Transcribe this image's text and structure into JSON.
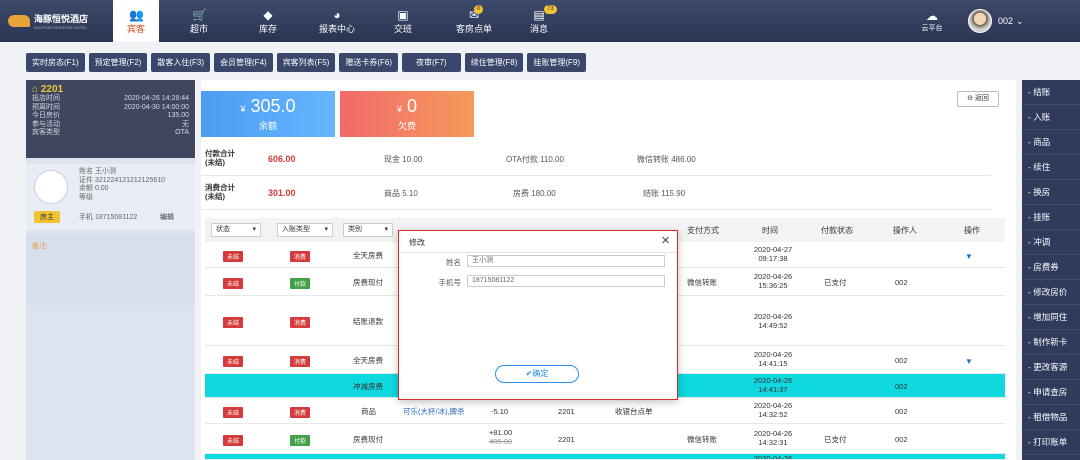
{
  "brand": {
    "name": "海豚恒悦酒店",
    "sub": "DOLPHIN HENGYUE HOTEL"
  },
  "nav": [
    {
      "label": "宾客",
      "icon": "guests-icon"
    },
    {
      "label": "超市",
      "icon": "cart-icon"
    },
    {
      "label": "库存",
      "icon": "box-icon"
    },
    {
      "label": "报表中心",
      "icon": "chart-icon"
    },
    {
      "label": "交班",
      "icon": "handover-icon"
    },
    {
      "label": "客房点单",
      "icon": "order-icon",
      "badge": "0"
    },
    {
      "label": "消息",
      "icon": "message-icon",
      "badge": "73"
    }
  ],
  "cloud_label": "云平台",
  "user_name": "002",
  "tabs": [
    "实时房态(F1)",
    "预定管理(F2)",
    "散客入住(F3)",
    "会员管理(F4)",
    "宾客列表(F5)",
    "赠送卡券(F6)",
    "夜审(F7)",
    "续住管理(F8)",
    "挂账管理(F9)"
  ],
  "room": {
    "number": "2201",
    "rows": [
      {
        "k": "抵店时间",
        "v": "2020-04-26 14:28:44"
      },
      {
        "k": "预离时间",
        "v": "2020-04-30 14:00:00"
      },
      {
        "k": "今日房价",
        "v": "135.00"
      },
      {
        "k": "参与活动",
        "v": "无"
      },
      {
        "k": "宾客类型",
        "v": "OTA"
      }
    ]
  },
  "guest": {
    "name": "姓名  王小测",
    "id": "证件  321224121212125610",
    "balance": "余额  0.00",
    "level": "等级",
    "master": "房主",
    "phone": "手机  18715081122",
    "edit": "编辑",
    "remark": "备注:"
  },
  "summary": {
    "balance_value": "305.0",
    "balance_label": "余额",
    "arrears_value": "0",
    "arrears_label": "欠费",
    "currency": "¥",
    "back": "返回",
    "pay_label_1": "付款合计",
    "pay_label_2": "(未结)",
    "pay_total": "606.00",
    "pay_items": [
      "现金  10.00",
      "OTA付款  110.00",
      "微信转账  486.00"
    ],
    "cons_label_1": "消费合计",
    "cons_label_2": "(未结)",
    "cons_total": "301.00",
    "cons_items": [
      "商品  5.10",
      "房费  180.00",
      "结账  115.90"
    ]
  },
  "table": {
    "filters": [
      "状态",
      "入账类型",
      "类别"
    ],
    "headers": [
      "支付方式",
      "时间",
      "付款状态",
      "操作人",
      "操作"
    ],
    "rows": [
      {
        "status": "未结",
        "type": "消费",
        "type_color": "red",
        "cat": "全天房费",
        "date": "2020-04-27",
        "time": "09:17:38",
        "caret": true
      },
      {
        "status": "未结",
        "type": "付款",
        "type_color": "green",
        "cat": "房费现付",
        "pay": "微信转账",
        "date": "2020-04-26",
        "time": "15:36:25",
        "paystatus": "已支付",
        "op": "002"
      },
      {
        "status": "未结",
        "type": "消费",
        "type_color": "red",
        "cat": "结账退款",
        "date": "2020-04-26",
        "time": "14:49:52"
      },
      {
        "status": "未结",
        "type": "消费",
        "type_color": "red",
        "cat": "全天房费",
        "date": "2020-04-26",
        "time": "14:41:15",
        "op": "002",
        "caret": true
      },
      {
        "cat": "冲减房费",
        "date": "2020-04-26",
        "time": "14:41:37",
        "op": "002",
        "highlight": true
      },
      {
        "status": "未结",
        "type": "消费",
        "type_color": "red",
        "cat": "商品",
        "item": "可乐(大杯/冰),脾杀",
        "amount": "-5.10",
        "room": "2201",
        "pay": "收银台点单",
        "date": "2020-04-26",
        "time": "14:32:52",
        "op": "002"
      },
      {
        "status": "未结",
        "type": "付款",
        "type_color": "green",
        "cat": "房费现付",
        "amount": "+81.00",
        "amount_old": "405.00",
        "room": "2201",
        "pay": "微信转账",
        "date": "2020-04-26",
        "time": "14:32:31",
        "paystatus": "已支付",
        "op": "002"
      }
    ],
    "partial_date": "2020-04-26"
  },
  "modal": {
    "title": "修改",
    "name_label": "姓名",
    "name_value": "王小测",
    "phone_label": "手机号",
    "phone_value": "18715081122",
    "ok": "✔确定"
  },
  "right_actions": [
    "结账",
    "入账",
    "商品",
    "续住",
    "换房",
    "挂账",
    "冲调",
    "房费券",
    "修改房价",
    "增加同住",
    "制作新卡",
    "更改客源",
    "申请查房",
    "租借物品",
    "打印账单"
  ]
}
